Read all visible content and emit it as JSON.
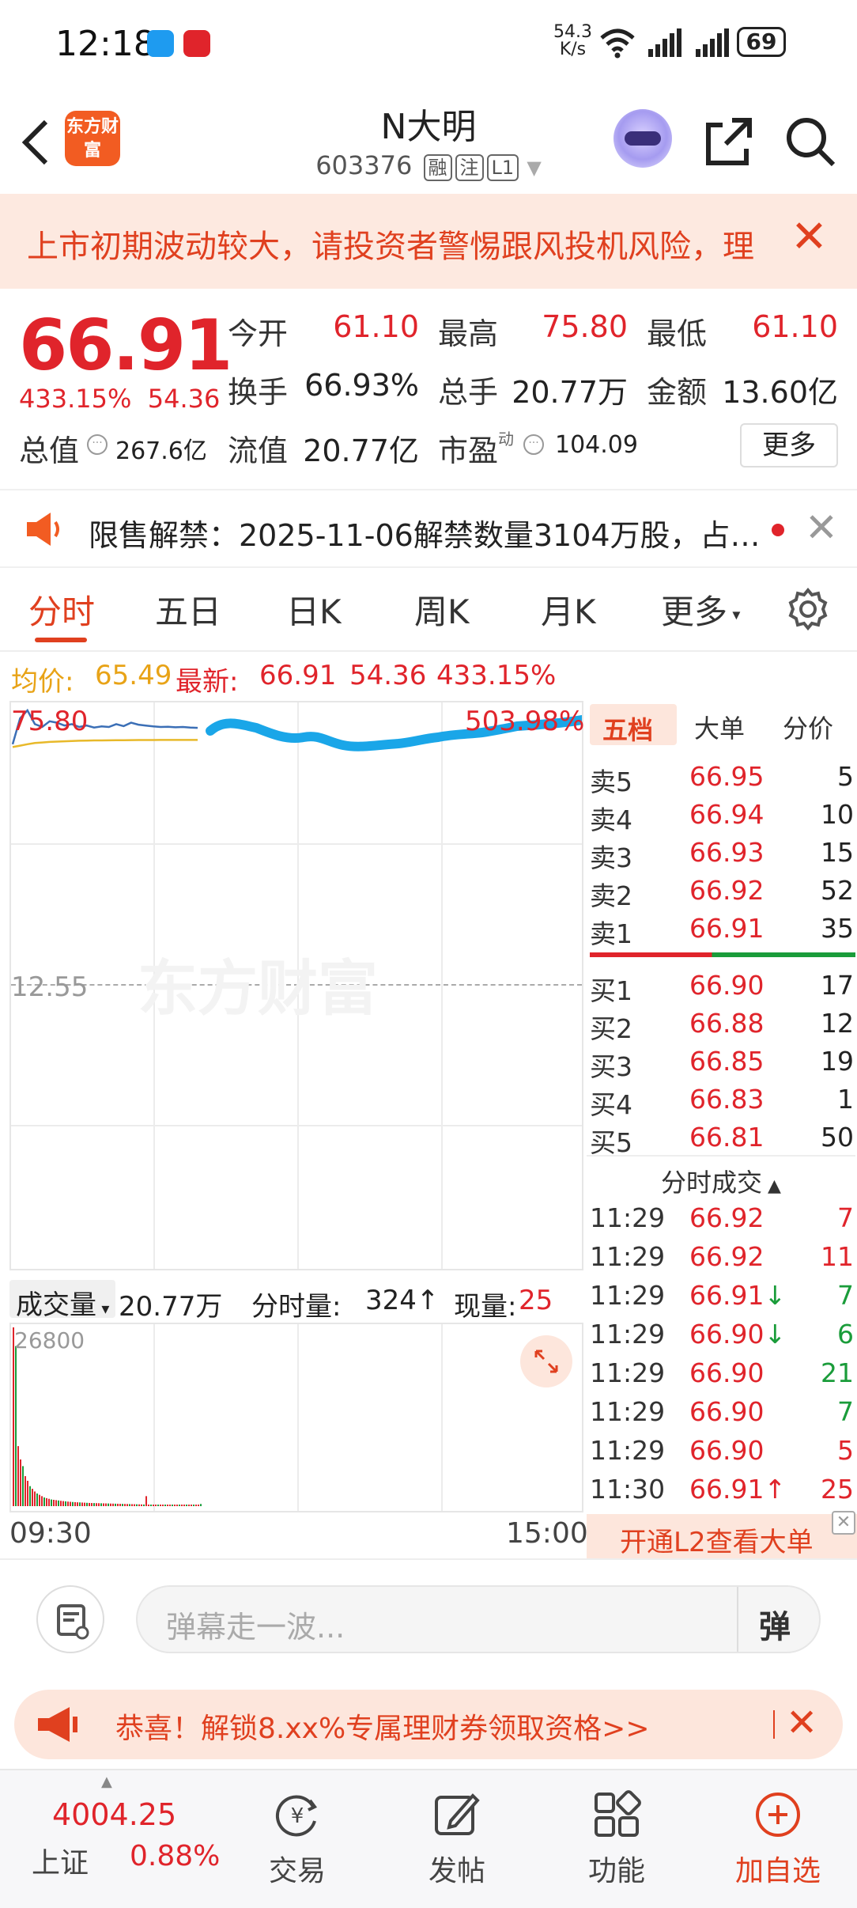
{
  "status_bar": {
    "time": "12:18",
    "net_speed": "54.3",
    "net_unit": "K/s",
    "battery": "69"
  },
  "header": {
    "logo_text": "东方财富",
    "stock_name": "N大明",
    "stock_code": "603376",
    "tags": [
      "融",
      "注",
      "L1"
    ]
  },
  "warning_banner": {
    "text": "上市初期波动较大，请投资者警惕跟风投机风险，理"
  },
  "quote": {
    "price": "66.91",
    "change_pct": "433.15%",
    "change_amt": "54.36",
    "fields": [
      {
        "label": "今开",
        "value": "61.10"
      },
      {
        "label": "最高",
        "value": "75.80"
      },
      {
        "label": "最低",
        "value": "61.10"
      },
      {
        "label": "换手",
        "value": "66.93%"
      },
      {
        "label": "总手",
        "value": "20.77万"
      },
      {
        "label": "金额",
        "value": "13.60亿"
      },
      {
        "label": "总值",
        "value": "267.6亿"
      },
      {
        "label": "流值",
        "value": "20.77亿"
      },
      {
        "label": "市盈",
        "value": "104.09",
        "sup": "动"
      }
    ],
    "more_label": "更多"
  },
  "notice": {
    "text": "限售解禁：2025-11-06解禁数量3104万股，占…"
  },
  "tabs": [
    "分时",
    "五日",
    "日K",
    "周K",
    "月K",
    "更多"
  ],
  "avg_line": {
    "avg_label": "均价:",
    "avg_value": "65.49",
    "latest_label": "最新:",
    "latest_value": "66.91",
    "change_amt": "54.36",
    "change_pct": "433.15%"
  },
  "chart_data": {
    "type": "line",
    "high_label": "75.80",
    "high_pct_label": "503.98%",
    "mid_label": "12.55",
    "watermark": "东方财富",
    "series": [
      {
        "values": [
          64,
          73,
          75.8,
          71,
          70,
          72,
          71.5,
          70.5,
          71,
          70,
          70.5,
          69.8,
          70.2,
          70,
          71,
          70.3,
          71.5,
          70.8,
          70.5,
          70.2,
          70,
          70.1,
          69.9,
          70,
          69.8,
          69.7
        ]
      },
      {
        "values": [
          63,
          63.5,
          64,
          64.4,
          64.6,
          64.8,
          64.9,
          65,
          65.1,
          65.2,
          65.25,
          65.3,
          65.32,
          65.35,
          65.37,
          65.4,
          65.42,
          65.44,
          65.45,
          65.46,
          65.47,
          65.48,
          65.49,
          65.49,
          65.49,
          65.49
        ]
      }
    ],
    "annotation_stroke": {
      "color": "#1aa6e8"
    }
  },
  "volume": {
    "label": "成交量",
    "total": "20.77万",
    "tick_label": "分时量:",
    "tick_value": "324↑",
    "now_label": "现量:",
    "now_value": "25",
    "max_label": "26800",
    "bars": [
      26800,
      24000,
      9000,
      7000,
      6000,
      4500,
      3800,
      3000,
      2600,
      2200,
      1900,
      1700,
      1500,
      1300,
      1200,
      1100,
      1000,
      950,
      900,
      850,
      800,
      760,
      720,
      680,
      650,
      620,
      600,
      580,
      560,
      540,
      520,
      500,
      480,
      470,
      460,
      450,
      440,
      430,
      420,
      410,
      400,
      390,
      380,
      370,
      360,
      350,
      340,
      330,
      320,
      310,
      300,
      290,
      280,
      270,
      260,
      250,
      1500,
      240,
      230,
      220,
      210,
      200,
      190,
      180,
      170,
      160,
      150,
      140,
      130,
      120,
      110,
      100,
      90,
      80,
      70,
      60,
      50,
      40,
      30,
      324
    ],
    "time_start": "09:30",
    "time_end": "15:00"
  },
  "order_book": {
    "tabs": [
      "五档",
      "大单",
      "分价"
    ],
    "asks": [
      {
        "label": "卖5",
        "price": "66.95",
        "vol": "5"
      },
      {
        "label": "卖4",
        "price": "66.94",
        "vol": "10"
      },
      {
        "label": "卖3",
        "price": "66.93",
        "vol": "15"
      },
      {
        "label": "卖2",
        "price": "66.92",
        "vol": "52"
      },
      {
        "label": "卖1",
        "price": "66.91",
        "vol": "35"
      }
    ],
    "bids": [
      {
        "label": "买1",
        "price": "66.90",
        "vol": "17"
      },
      {
        "label": "买2",
        "price": "66.88",
        "vol": "12"
      },
      {
        "label": "买3",
        "price": "66.85",
        "vol": "19"
      },
      {
        "label": "买4",
        "price": "66.83",
        "vol": "1"
      },
      {
        "label": "买5",
        "price": "66.81",
        "vol": "50"
      }
    ],
    "ticks_title": "分时成交",
    "ticks": [
      {
        "time": "11:29",
        "price": "66.92",
        "vol": "7",
        "dir": "",
        "color": "red"
      },
      {
        "time": "11:29",
        "price": "66.92",
        "vol": "11",
        "dir": "",
        "color": "red"
      },
      {
        "time": "11:29",
        "price": "66.91",
        "vol": "7",
        "dir": "↓",
        "color": "green"
      },
      {
        "time": "11:29",
        "price": "66.90",
        "vol": "6",
        "dir": "↓",
        "color": "green"
      },
      {
        "time": "11:29",
        "price": "66.90",
        "vol": "21",
        "dir": "",
        "color": "green"
      },
      {
        "time": "11:29",
        "price": "66.90",
        "vol": "7",
        "dir": "",
        "color": "green"
      },
      {
        "time": "11:29",
        "price": "66.90",
        "vol": "5",
        "dir": "",
        "color": "red"
      },
      {
        "time": "11:30",
        "price": "66.91",
        "vol": "25",
        "dir": "↑",
        "color": "red"
      }
    ],
    "l2_label": "开通L2查看大单"
  },
  "comment_bar": {
    "placeholder": "弹幕走一波...",
    "danmaku_label": "弹"
  },
  "promo": {
    "text": "恭喜！解锁8.xx%专属理财券领取资格>>"
  },
  "bottom_nav": {
    "index_value": "4004.25",
    "index_name": "上证",
    "index_pct": "0.88%",
    "items": [
      "交易",
      "发帖",
      "功能",
      "加自选"
    ]
  }
}
